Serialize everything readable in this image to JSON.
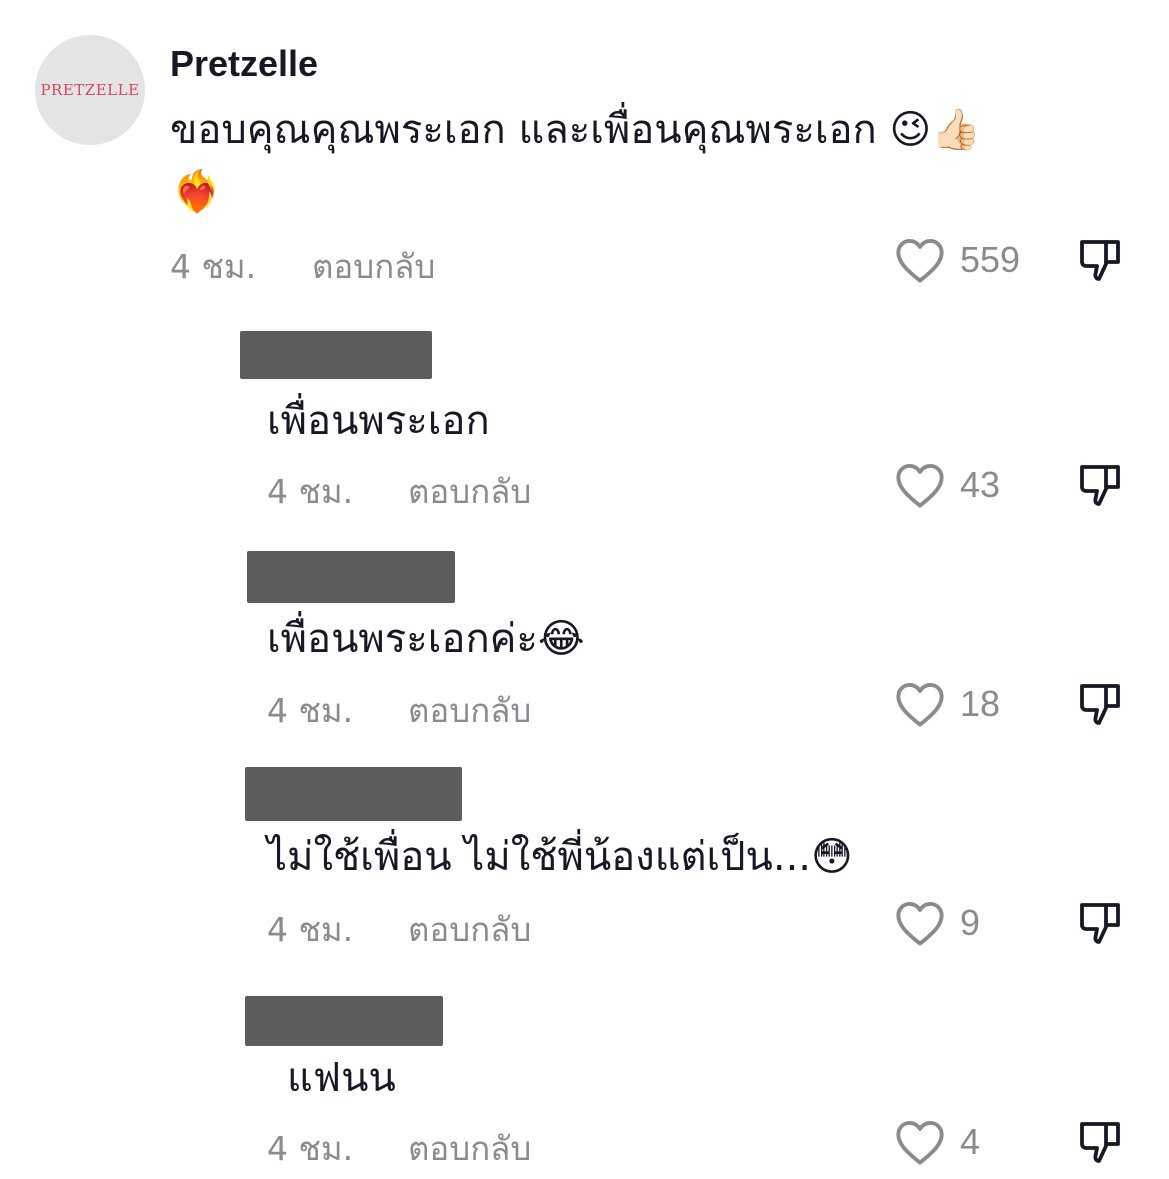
{
  "comments": [
    {
      "avatar_text": "PRETZELLE",
      "username": "Pretzelle",
      "text_line1": "ขอบคุณคุณพระเอก และเพื่อนคุณพระเอก 😉👍🏻",
      "text_line2": "❤️‍🔥",
      "time": "4 ชม.",
      "reply_label": "ตอบกลับ",
      "likes": "559"
    },
    {
      "text": "เพื่อนพระเอก",
      "time": "4 ชม.",
      "reply_label": "ตอบกลับ",
      "likes": "43"
    },
    {
      "text": "เพื่อนพระเอกค่ะ😂",
      "time": "4 ชม.",
      "reply_label": "ตอบกลับ",
      "likes": "18"
    },
    {
      "text": "ไม่ใช้เพื่อน ไม่ใช้พี่น้องแต่เป็น...😳",
      "time": "4 ชม.",
      "reply_label": "ตอบกลับ",
      "likes": "9"
    },
    {
      "text": "แฟนน",
      "time": "4 ชม.",
      "reply_label": "ตอบกลับ",
      "likes": "4"
    }
  ],
  "colors": {
    "text": "#161823",
    "meta": "#8a8b91",
    "redacted": "#5c5c5c",
    "avatar_bg": "#e4e4e4",
    "avatar_text": "#d5485c"
  },
  "icons": {
    "like": "heart-outline-icon",
    "dislike": "thumbs-down-outline-icon"
  }
}
